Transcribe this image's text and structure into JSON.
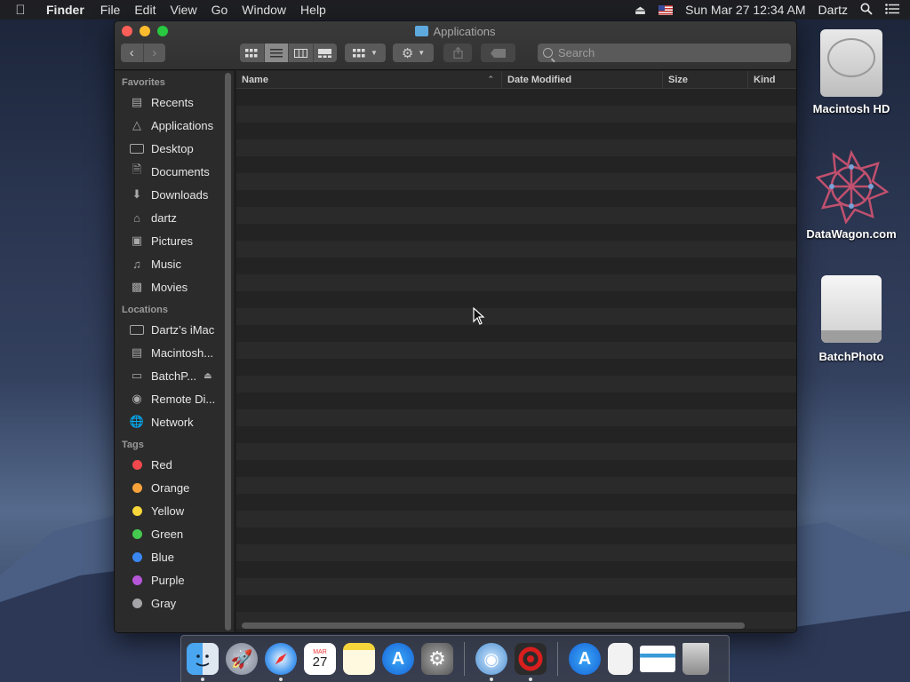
{
  "menubar": {
    "apple": "",
    "app": "Finder",
    "items": [
      "File",
      "Edit",
      "View",
      "Go",
      "Window",
      "Help"
    ],
    "datetime": "Sun Mar 27  12:34 AM",
    "user": "Dartz",
    "icons": [
      "eject-icon",
      "us-flag-icon",
      "spotlight-icon",
      "notification-list-icon"
    ]
  },
  "window": {
    "title": "Applications",
    "search_placeholder": "Search",
    "view_modes": [
      "icon-view",
      "list-view",
      "column-view",
      "gallery-view"
    ],
    "active_view": "list-view"
  },
  "sidebar": {
    "favorites_header": "Favorites",
    "favorites": [
      {
        "label": "Recents",
        "icon": "recents-icon"
      },
      {
        "label": "Applications",
        "icon": "applications-icon"
      },
      {
        "label": "Desktop",
        "icon": "desktop-icon"
      },
      {
        "label": "Documents",
        "icon": "documents-icon"
      },
      {
        "label": "Downloads",
        "icon": "downloads-icon"
      },
      {
        "label": "dartz",
        "icon": "home-icon"
      },
      {
        "label": "Pictures",
        "icon": "pictures-icon"
      },
      {
        "label": "Music",
        "icon": "music-icon"
      },
      {
        "label": "Movies",
        "icon": "movies-icon"
      }
    ],
    "locations_header": "Locations",
    "locations": [
      {
        "label": "Dartz’s iMac",
        "icon": "imac-icon"
      },
      {
        "label": "Macintosh...",
        "icon": "hard-disk-icon"
      },
      {
        "label": "BatchP...",
        "icon": "external-disk-icon"
      },
      {
        "label": "Remote Di...",
        "icon": "remote-disc-icon"
      },
      {
        "label": "Network",
        "icon": "network-icon"
      }
    ],
    "tags_header": "Tags",
    "tags": [
      {
        "label": "Red",
        "color": "#f0484d"
      },
      {
        "label": "Orange",
        "color": "#f7a23a"
      },
      {
        "label": "Yellow",
        "color": "#f6d63a"
      },
      {
        "label": "Green",
        "color": "#45c94f"
      },
      {
        "label": "Blue",
        "color": "#3a87f2"
      },
      {
        "label": "Purple",
        "color": "#b657d9"
      },
      {
        "label": "Gray",
        "color": "#a5a5a8"
      }
    ]
  },
  "list": {
    "columns": [
      "Name",
      "Date Modified",
      "Size",
      "Kind"
    ],
    "sort_column": "Name",
    "rows": []
  },
  "desktop": {
    "icons": [
      {
        "label": "Macintosh HD",
        "icon": "hard-drive-icon"
      },
      {
        "label": "DataWagon.com",
        "icon": "datawagon-logo-icon"
      },
      {
        "label": "BatchPhoto",
        "icon": "removable-disk-icon"
      }
    ]
  },
  "dock": {
    "apps": [
      "finder-icon",
      "launchpad-icon",
      "safari-icon",
      "calendar-icon",
      "notes-icon",
      "app-store-icon",
      "system-preferences-icon",
      "network-radar-icon",
      "batchphoto-icon",
      "app-store-folder-icon",
      "document-icon",
      "downloads-stack-icon",
      "trash-icon"
    ],
    "calendar_month": "MAR",
    "calendar_day": "27"
  }
}
